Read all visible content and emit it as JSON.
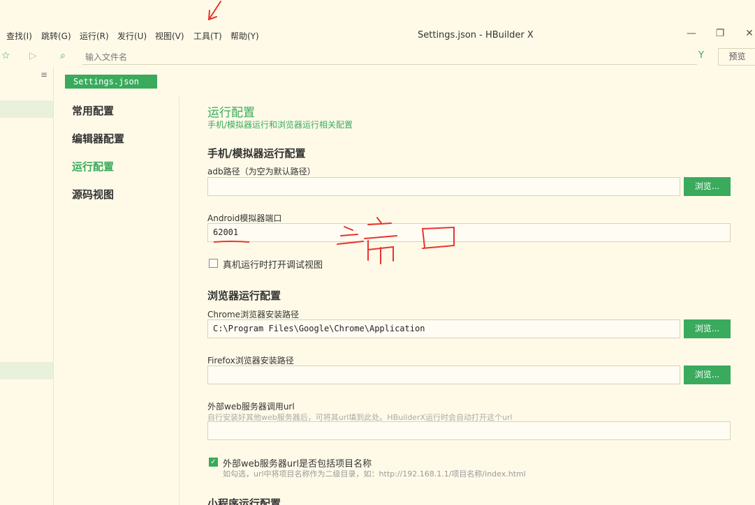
{
  "menubar": {
    "items": [
      "查找(I)",
      "跳转(G)",
      "运行(R)",
      "发行(U)",
      "视图(V)",
      "工具(T)",
      "帮助(Y)"
    ],
    "window_title": "Settings.json - HBuilder X"
  },
  "toolbar": {
    "search_placeholder": "输入文件名",
    "preview_label": "预览"
  },
  "editor": {
    "tab_label": "Settings.json"
  },
  "nav": {
    "items": [
      "常用配置",
      "编辑器配置",
      "运行配置",
      "源码视图"
    ],
    "active_index": 2
  },
  "section": {
    "title": "运行配置",
    "subtitle": "手机/模拟器运行和浏览器运行相关配置"
  },
  "mobile": {
    "title": "手机/模拟器运行配置",
    "adb_label": "adb路径（为空为默认路径）",
    "adb_value": "",
    "adb_browse": "浏览...",
    "android_port_label": "Android模拟器端口",
    "android_port_value": "62001",
    "debug_view_label": "真机运行时打开调试视图",
    "debug_view_checked": false
  },
  "browser": {
    "title": "浏览器运行配置",
    "chrome_label": "Chrome浏览器安装路径",
    "chrome_value": "C:\\Program Files\\Google\\Chrome\\Application",
    "chrome_browse": "浏览...",
    "firefox_label": "Firefox浏览器安装路径",
    "firefox_value": "",
    "firefox_browse": "浏览...",
    "web_url_label": "外部web服务器调用url",
    "web_url_hint": "自行安装好其他web服务器后，可将其url填到此处。HBuilderX运行时会自动打开这个url",
    "web_url_value": "",
    "include_project_label": "外部web服务器url是否包括项目名称",
    "include_project_hint": "如勾选，url中将项目名称作为二级目录，如：http://192.168.1.1/项目名称/index.html",
    "include_project_checked": true
  },
  "miniprogram": {
    "title": "小程序运行配置"
  },
  "colors": {
    "accent": "#3aaa5c",
    "background": "#fffae8",
    "annotation": "#e8332f"
  }
}
